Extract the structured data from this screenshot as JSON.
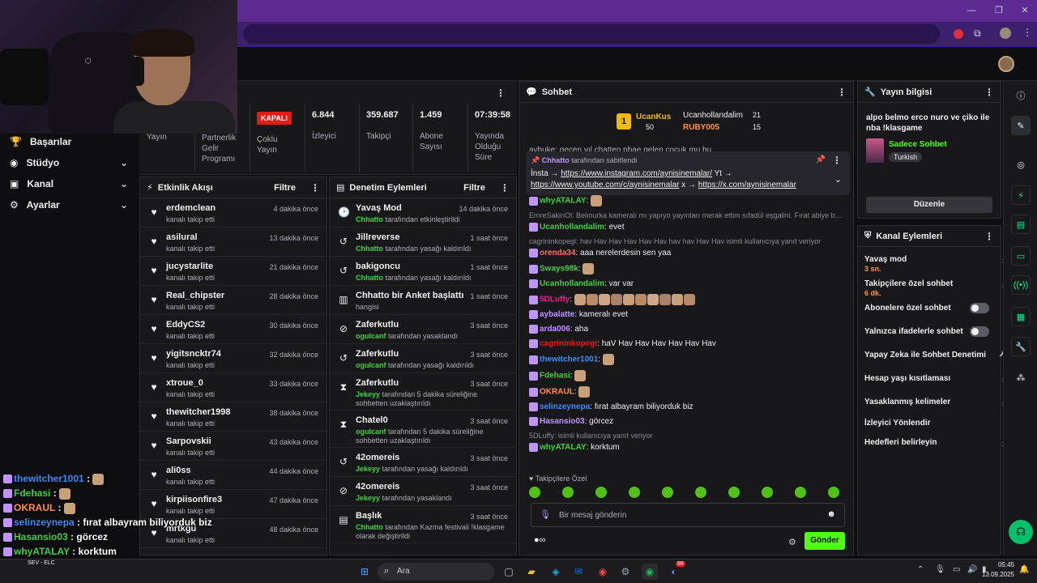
{
  "stats": {
    "left_labels": [
      "Yayın",
      "Partnerlik Gelir Programı",
      "Çoklu Yayın"
    ],
    "status_badge": "KAPALI",
    "items": [
      {
        "value": "6.844",
        "label": "İzleyici"
      },
      {
        "value": "359.687",
        "label": "Takipçi"
      },
      {
        "value": "1.459",
        "label": "Abone Sayısı"
      },
      {
        "value": "07:39:58",
        "label": "Yayında Olduğu Süre"
      }
    ]
  },
  "left_nav": [
    {
      "label": "Başarılar",
      "icon": "trophy-icon"
    },
    {
      "label": "Stüdyo",
      "icon": "studio-icon"
    },
    {
      "label": "Kanal",
      "icon": "channel-icon"
    },
    {
      "label": "Ayarlar",
      "icon": "gear-icon"
    }
  ],
  "activity": {
    "title": "Etkinlik Akışı",
    "filter": "Filtre",
    "items": [
      {
        "name": "erdemclean",
        "sub": "kanalı takip etti",
        "time": "4 dakika önce"
      },
      {
        "name": "asilural",
        "sub": "kanalı takip etti",
        "time": "13 dakika önce"
      },
      {
        "name": "jucystarlite",
        "sub": "kanalı takip etti",
        "time": "21 dakika önce"
      },
      {
        "name": "Real_chipster",
        "sub": "kanalı takip etti",
        "time": "28 dakika önce"
      },
      {
        "name": "EddyCS2",
        "sub": "kanalı takip etti",
        "time": "30 dakika önce"
      },
      {
        "name": "yigitsncktr74",
        "sub": "kanalı takip etti",
        "time": "32 dakika önce"
      },
      {
        "name": "xtroue_0",
        "sub": "kanalı takip etti",
        "time": "33 dakika önce"
      },
      {
        "name": "thewitcher1998",
        "sub": "kanalı takip etti",
        "time": "38 dakika önce"
      },
      {
        "name": "Sarpovskii",
        "sub": "kanalı takip etti",
        "time": "43 dakika önce"
      },
      {
        "name": "ali0ss",
        "sub": "kanalı takip etti",
        "time": "44 dakika önce"
      },
      {
        "name": "kirpiisonfire3",
        "sub": "kanalı takip etti",
        "time": "47 dakika önce"
      },
      {
        "name": "mrtkgu",
        "sub": "kanalı takip etti",
        "time": "48 dakika önce"
      }
    ]
  },
  "moderation": {
    "title": "Denetim Eylemleri",
    "filter": "Filtre",
    "items": [
      {
        "name": "Yavaş Mod",
        "actor": "Chhatto",
        "rest": " tarafından etkinleştirildi",
        "time": "14 dakika önce",
        "icon": "slow-mode-icon"
      },
      {
        "name": "Jillreverse",
        "actor": "Chhatto",
        "rest": " tarafından yasağı kaldırıldı",
        "time": "1 saat önce",
        "icon": "undo-icon"
      },
      {
        "name": "bakigoncu",
        "actor": "Chhatto",
        "rest": " tarafından yasağı kaldırıldı",
        "time": "1 saat önce",
        "icon": "undo-icon"
      },
      {
        "name": "Chhatto bir Anket başlattı",
        "actor": "",
        "rest": "hangisi",
        "time": "1 saat önce",
        "icon": "poll-icon"
      },
      {
        "name": "Zaferkutlu",
        "actor": "ogulcanf",
        "rest": " tarafından yasaklandı",
        "time": "3 saat önce",
        "icon": "ban-icon"
      },
      {
        "name": "Zaferkutlu",
        "actor": "ogulcanf",
        "rest": " tarafından yasağı kaldırıldı",
        "time": "3 saat önce",
        "icon": "undo-icon"
      },
      {
        "name": "Zaferkutlu",
        "actor": "Jekeyy",
        "rest": " tarafından 5 dakika süreliğine sohbetten uzaklaştırıldı",
        "time": "3 saat önce",
        "icon": "timeout-icon"
      },
      {
        "name": "Chatel0",
        "actor": "ogulcanf",
        "rest": " tarafından 5 dakika süreliğine sohbetten uzaklaştırıldı",
        "time": "3 saat önce",
        "icon": "timeout-icon"
      },
      {
        "name": "42omereis",
        "actor": "Jekeyy",
        "rest": " tarafından yasağı kaldırıldı",
        "time": "3 saat önce",
        "icon": "undo-icon"
      },
      {
        "name": "42omereis",
        "actor": "Jekeyy",
        "rest": " tarafından yasaklandı",
        "time": "3 saat önce",
        "icon": "ban-icon"
      },
      {
        "name": "Başlık",
        "actor": "Chhatto",
        "rest": " tarafından Kazma festivali !klasgame olarak değiştirildi",
        "time": "3 saat önce",
        "icon": "title-icon"
      }
    ]
  },
  "chat": {
    "title": "Sohbet",
    "leaderboard": {
      "first_name": "UcanKus",
      "first_value": "50",
      "second_name": "Ucanhollandalim",
      "second_value": "21",
      "third_name": "RUBY005",
      "third_value": "15"
    },
    "cutoff_line": "aybuke: geçen yıl chatten pbae gelen çocuk mu bu",
    "pinned": {
      "by": "Chhatto",
      "by_text": " tarafından sabitlendi",
      "line1_prefix": "İnsta → ",
      "line1_link": "https://www.instagram.com/aynisinemalar/",
      "line1_suffix": " Yt →",
      "line2_link": "https://www.youtube.com/c/aynisinemalar",
      "line2_mid": " x → ",
      "line2_link2": "https://x.com/aynisinemalar"
    },
    "messages": [
      {
        "user": "whyATALAY",
        "color": "#43d043",
        "text": "",
        "emotes": 1
      },
      {
        "reply": "EmreSakinOl: Belmurka kameralı mı yapıyo yayınları merak ettim sıfadül eşgalini. Fırat abiye ben..."
      },
      {
        "user": "Ucanhollandalim",
        "color": "#43d043",
        "text": "evet",
        "emotes": 0
      },
      {
        "reply": "cagrininkopegi: hav Hav Hav Hav Hav Hav hav hav Hav Hav isimli kullanıcıya yanıt veriyor"
      },
      {
        "user": "orenda34",
        "color": "#ff6b6b",
        "text": "aaa nerelerdesin sen yaa",
        "emotes": 0
      },
      {
        "user": "Sways98k",
        "color": "#43d043",
        "text": "",
        "emotes": 1
      },
      {
        "user": "Ucanhollandalim",
        "color": "#43d043",
        "text": "var var",
        "emotes": 0
      },
      {
        "user": "5DLuffy",
        "color": "#e91e8c",
        "text": "",
        "emotes": 10
      },
      {
        "user": "aybalatte",
        "color": "#bf94ff",
        "text": "kameralı evet",
        "emotes": 0
      },
      {
        "user": "arda006",
        "color": "#bf94ff",
        "text": "aha",
        "emotes": 0
      },
      {
        "user": "cagrininkopegi",
        "color": "#e91916",
        "text": "haV Hav Hav Hav Hav Hav Hav",
        "emotes": 0
      },
      {
        "user": "thewitcher1001",
        "color": "#3e8df5",
        "text": "",
        "emotes": 1
      },
      {
        "user": "Fdehasi",
        "color": "#43d043",
        "text": "",
        "emotes": 1
      },
      {
        "user": "OKRAUL",
        "color": "#ff9147",
        "text": "",
        "emotes": 1
      },
      {
        "user": "selinzeynepa",
        "color": "#3e8df5",
        "text": "fırat albayram biliyorduk biz",
        "emotes": 0
      },
      {
        "user": "Hasansio03",
        "color": "#bf94ff",
        "text": "görcez",
        "emotes": 0
      },
      {
        "reply": "5DLuffy: isimli kullanıcıya yanıt veriyor"
      },
      {
        "user": "whyATALAY",
        "color": "#43d043",
        "text": "korktum",
        "emotes": 0
      }
    ],
    "followers_only": "Takipçilere Özel",
    "input_placeholder": "Bir mesaj gönderin",
    "send_label": "Gönder"
  },
  "stream_info": {
    "title": "Yayın bilgisi",
    "stream_title": "alpo belmo erco nuro ve çiko ile nba !klasgame",
    "category": "Sadece Sohbet",
    "tag": "Turkish",
    "edit_label": "Düzenle"
  },
  "channel_actions": {
    "title": "Kanal Eylemleri",
    "items": [
      {
        "label": "Yavaş mod",
        "sub": "3 sn.",
        "type": "arrow"
      },
      {
        "label": "Takipçilere özel sohbet",
        "sub": "6 dk.",
        "type": "arrow"
      },
      {
        "label": "Abonelere özel sohbet",
        "sub": "",
        "type": "toggle"
      },
      {
        "label": "Yalnızca ifadelerle sohbet",
        "sub": "",
        "type": "toggle"
      },
      {
        "label": "Yapay Zeka ile Sohbet Denetimi",
        "sub": "",
        "type": "external"
      },
      {
        "label": "Hesap yaşı kısıtlaması",
        "sub": "",
        "type": "arrow"
      },
      {
        "label": "Yasaklanmış kelimeler",
        "sub": "",
        "type": "arrow"
      },
      {
        "label": "İzleyici Yönlendir",
        "sub": "",
        "type": "none"
      },
      {
        "label": "Hedefleri belirleyin",
        "sub": "",
        "type": "arrow"
      }
    ]
  },
  "overlay_chat": [
    {
      "user": "thewitcher1001",
      "color": "#3e8df5",
      "text": ""
    },
    {
      "user": "Fdehasi",
      "color": "#43d043",
      "text": ""
    },
    {
      "user": "OKRAUL",
      "color": "#ff9147",
      "text": ""
    },
    {
      "user": "selinzeynepa",
      "color": "#3e8df5",
      "text": "fırat albayram biliyorduk biz"
    },
    {
      "user": "Hasansio03",
      "color": "#43d043",
      "text": "görcez"
    },
    {
      "user": "whyATALAY",
      "color": "#43d043",
      "text": "korktum"
    }
  ],
  "taskbar": {
    "search_label": "Ara",
    "time": "05:45",
    "date": "13.09.2025",
    "notif_count": "99",
    "media_title": "SEV - ELC"
  }
}
